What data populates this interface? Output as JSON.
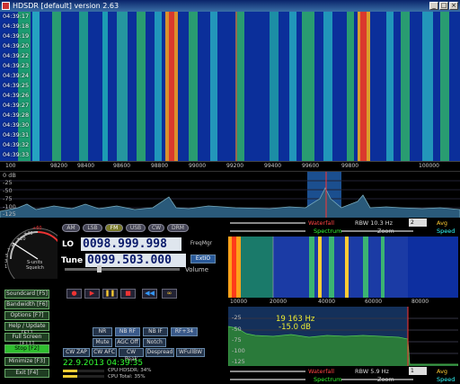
{
  "window": {
    "title": "HDSDR [default] version 2.63",
    "min": "_",
    "max": "□",
    "close": "×"
  },
  "waterfall_top": {
    "times": [
      "04:39:17",
      "04:39:18",
      "04:39:19",
      "04:39:20",
      "04:39:22",
      "04:39:23",
      "04:39:24",
      "04:39:25",
      "04:39:26",
      "04:39:27",
      "04:39:28",
      "04:39:30",
      "04:39:31",
      "04:39:32",
      "04:39:33",
      "04:39:34"
    ]
  },
  "scale_top": {
    "ticks": [
      "100",
      "98200",
      "98400",
      "98600",
      "98800",
      "99000",
      "99200",
      "99400",
      "99600",
      "99800",
      "100000"
    ]
  },
  "spectrum_top": {
    "db": [
      "0 dB",
      "-25",
      "-50",
      "-75",
      "-100",
      "-125"
    ]
  },
  "smeter": {
    "labels": [
      "+60",
      "+40",
      "+20",
      "9",
      "7",
      "5",
      "3",
      "1"
    ],
    "title": "S-units",
    "subtitle": "Squelch"
  },
  "modes": [
    "AM",
    "LSB",
    "FM",
    "USB",
    "CW",
    "DRM"
  ],
  "lo": {
    "label": "LO",
    "value": "0098.999.998",
    "button": "FreqMgr"
  },
  "tune": {
    "label": "Tune",
    "value": "0099.503.000",
    "button": "ExtIO",
    "volume": "Volume"
  },
  "left_buttons": [
    "Soundcard [F5]",
    "Bandwidth [F6]",
    "Options [F7]",
    "Help / Update [F1]",
    "Full Screen [F11]",
    "Stop [F2]",
    "Minimize [F3]",
    "Exit [F4]"
  ],
  "dsp": [
    "NR",
    "NB RF",
    "NB IF",
    "RF+34"
  ],
  "dsp2": [
    "Mute",
    "AGC Off",
    "Notch"
  ],
  "dsp3": [
    "CW ZAP",
    "CW AFC",
    "CW Peak",
    "Despread",
    "WFullBW"
  ],
  "status": {
    "datetime": "22.9.2013 04:39:35",
    "cpu_hdsdr": "CPU HDSDR: 34%",
    "cpu_total": "CPU Total: 35%"
  },
  "upper_controls": {
    "waterfall": "Waterfall",
    "spectrum": "Spectrum",
    "rbw": "RBW 10.3 Hz",
    "avg_val": "2",
    "avg": "Avg",
    "zoom": "Zoom",
    "speed": "Speed"
  },
  "audio_scale": [
    "10000",
    "20000",
    "40000",
    "60000",
    "80000"
  ],
  "audio_spectrum": {
    "db": [
      "-25",
      "-50",
      "-75",
      "-100",
      "-125"
    ],
    "marker": "19 163 Hz",
    "marker_db": "-15.0 dB"
  },
  "lower_controls": {
    "waterfall": "Waterfall",
    "spectrum": "Spectrum",
    "rbw": "RBW 5.9 Hz",
    "avg_val": "1",
    "avg": "Avg",
    "zoom": "Zoom",
    "speed": "Speed"
  }
}
